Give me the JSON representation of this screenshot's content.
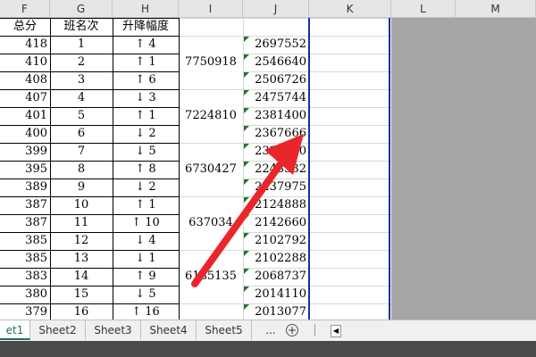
{
  "columns": [
    "F",
    "G",
    "H",
    "I",
    "J",
    "K",
    "L",
    "M"
  ],
  "header_row": {
    "f": "总分",
    "g": "班名次",
    "h": "升降幅度"
  },
  "rows": [
    {
      "f": "418",
      "g": "1",
      "dir": "↑",
      "chg": "4"
    },
    {
      "f": "410",
      "g": "2",
      "dir": "↑",
      "chg": "1"
    },
    {
      "f": "408",
      "g": "3",
      "dir": "↑",
      "chg": "6"
    },
    {
      "f": "407",
      "g": "4",
      "dir": "↓",
      "chg": "3"
    },
    {
      "f": "401",
      "g": "5",
      "dir": "↑",
      "chg": "1"
    },
    {
      "f": "400",
      "g": "6",
      "dir": "↓",
      "chg": "2"
    },
    {
      "f": "399",
      "g": "7",
      "dir": "↓",
      "chg": "5"
    },
    {
      "f": "395",
      "g": "8",
      "dir": "↑",
      "chg": "8"
    },
    {
      "f": "389",
      "g": "9",
      "dir": "↓",
      "chg": "2"
    },
    {
      "f": "387",
      "g": "10",
      "dir": "↑",
      "chg": "1"
    },
    {
      "f": "387",
      "g": "11",
      "dir": "↑",
      "chg": "10"
    },
    {
      "f": "385",
      "g": "12",
      "dir": "↓",
      "chg": "4"
    },
    {
      "f": "385",
      "g": "13",
      "dir": "↓",
      "chg": "1"
    },
    {
      "f": "383",
      "g": "14",
      "dir": "↑",
      "chg": "9"
    },
    {
      "f": "380",
      "g": "15",
      "dir": "↓",
      "chg": "5"
    },
    {
      "f": "379",
      "g": "16",
      "dir": "↑",
      "chg": "16"
    }
  ],
  "i_values": [
    "7750918",
    "7224810",
    "6730427",
    "637034",
    "6185135"
  ],
  "j_values": [
    "2697552",
    "2546640",
    "2506726",
    "2475744",
    "2381400",
    "2367666",
    "2328980",
    "2243332",
    "2237975",
    "2124888",
    "2142660",
    "2102792",
    "2102288",
    "2068737",
    "2014110",
    "2013077"
  ],
  "sheet_tabs": [
    "et1",
    "Sheet2",
    "Sheet3",
    "Sheet4",
    "Sheet5"
  ],
  "tab_more": "...",
  "tab_add_icon": "add-sheet-icon",
  "colors": {
    "arrow": "#e8262b",
    "selection_border": "#1a2fa0",
    "green_marker": "#1e7a1e",
    "gray": "#a6a6a6"
  }
}
